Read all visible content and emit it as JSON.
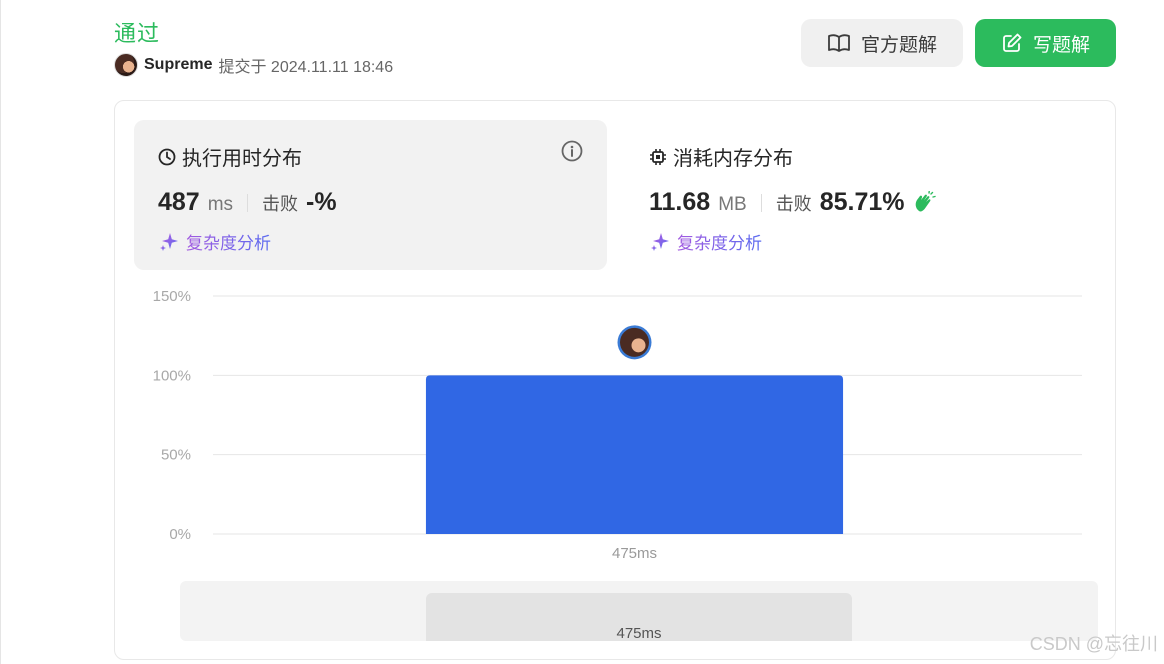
{
  "header": {
    "status": "通过",
    "username": "Supreme",
    "submit_meta": "提交于 2024.11.11 18:46",
    "editorial_button": "官方题解",
    "solution_button": "写题解"
  },
  "runtime": {
    "title": "执行用时分布",
    "value": "487",
    "unit": "ms",
    "beat_label": "击败",
    "beat_value": "-%",
    "complexity": "复杂度分析"
  },
  "memory": {
    "title": "消耗内存分布",
    "value": "11.68",
    "unit": "MB",
    "beat_label": "击败",
    "beat_value": "85.71%",
    "complexity": "复杂度分析"
  },
  "chart_data": {
    "type": "bar",
    "categories": [
      "475ms"
    ],
    "values": [
      100
    ],
    "ylim": [
      0,
      150
    ],
    "yticks": [
      "0%",
      "50%",
      "100%",
      "150%"
    ],
    "grid": true,
    "color": "#3067e4"
  },
  "range": {
    "label": "475ms"
  },
  "watermark": "CSDN @忘往川",
  "colors": {
    "accent": "#2cbb5d",
    "bar": "#3067e4"
  }
}
